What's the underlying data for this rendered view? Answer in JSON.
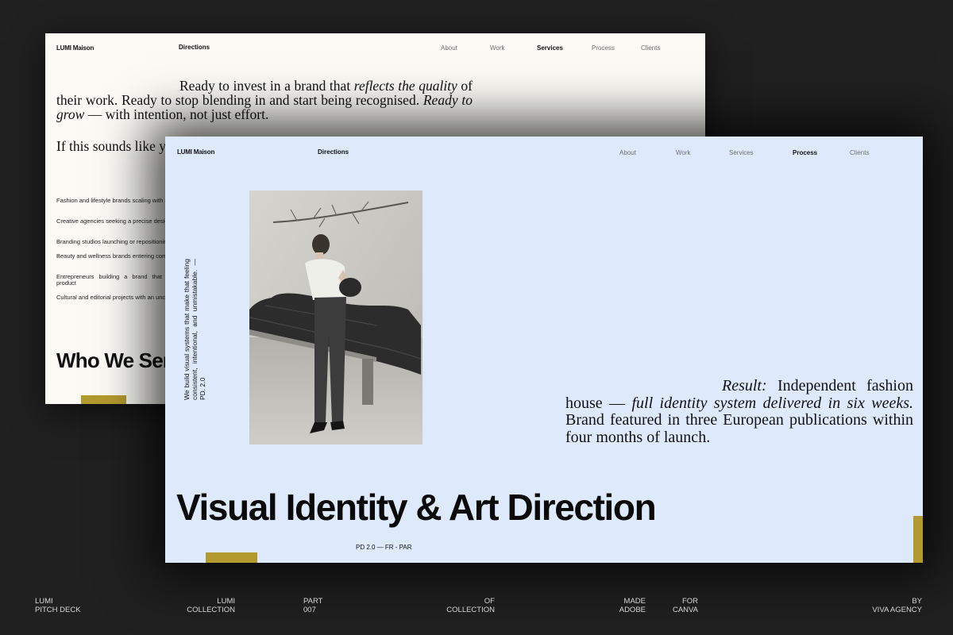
{
  "back_slide": {
    "brand": "LUMI Maison",
    "directions": "Directions",
    "nav": [
      "About",
      "Work",
      "Services",
      "Process",
      "Clients"
    ],
    "active_nav": "Services",
    "intro": {
      "p1": "Ready to invest in a brand that ",
      "p1_italic": "reflects the quality",
      "p2": " of their work. Ready to stop blending in and start being recognised. ",
      "p3_italic": "Ready to grow",
      "p4": " — with intention, not just effort."
    },
    "if_text": "If this sounds like you, we are ready too.",
    "list": [
      "Fashion and lifestyle brands scaling with purpose",
      "Creative agencies seeking a precise design partner",
      "Branding studios launching or repositioning",
      "Beauty and wellness brands entering competitive markets",
      "Entrepreneurs building a brand that outlives a single product",
      "Cultural and editorial projects with an uncompromising voice"
    ],
    "heading": "Who We Serve"
  },
  "front_slide": {
    "brand": "LUMI Maison",
    "directions": "Directions",
    "nav": [
      "About",
      "Work",
      "Services",
      "Process",
      "Clients"
    ],
    "active_nav": "Process",
    "vertical_text": "We build visual systems that make that feeling consistent, intentional, and unmistakable. — PD. 2.0",
    "photo_icon": "fashion-photo",
    "result": {
      "label": "Result:",
      "t1": " Independent fashion house — ",
      "t2_italic": "full identity system delivered in six weeks.",
      "t3": " Brand featured in three European publications within four months of launch."
    },
    "heading": "Visual Identity & Art Direction",
    "code": "PD 2.0 — FR - PAR"
  },
  "footer": [
    {
      "l1": "LUMI",
      "l2": "PITCH DECK"
    },
    {
      "l1": "LUMI",
      "l2": "COLLECTION"
    },
    {
      "l1": "PART",
      "l2": "007"
    },
    {
      "l1": "OF",
      "l2": "COLLECTION"
    },
    {
      "l1": "MADE",
      "l2": "ADOBE"
    },
    {
      "l1": "FOR",
      "l2": "CANVA"
    },
    {
      "l1": "BY",
      "l2": "VIVA AGENCY"
    }
  ],
  "colors": {
    "background": "#202020",
    "back_slide": "#fbfaf5",
    "front_slide": "#deeafb",
    "accent_gold": "#b39a2e"
  }
}
